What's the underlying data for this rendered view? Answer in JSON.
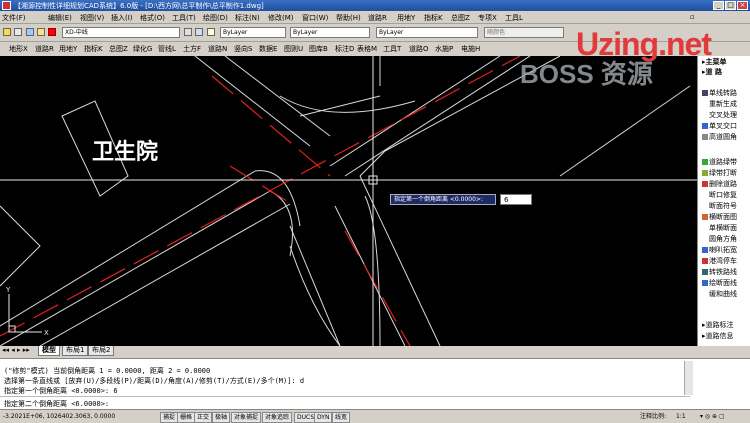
{
  "window": {
    "title": "【湘源控制性详细规划CAD系统】6.0版 - [D:\\西方网\\总平制作\\总平制作1.dwg]",
    "min": "_",
    "max": "□",
    "close": "×"
  },
  "menu": [
    {
      "label": "文件(F)"
    },
    {
      "label": "编辑(E)"
    },
    {
      "label": "视图(V)"
    },
    {
      "label": "插入(I)"
    },
    {
      "label": "格式(O)"
    },
    {
      "label": "工具(T)"
    },
    {
      "label": "绘图(D)"
    },
    {
      "label": "标注(N)"
    },
    {
      "label": "修改(M)"
    },
    {
      "label": "窗口(W)"
    },
    {
      "label": "帮助(H)"
    },
    {
      "label": "道路R"
    },
    {
      "label": "用地Y"
    },
    {
      "label": "指标K"
    },
    {
      "label": "总图Z"
    },
    {
      "label": "专项X"
    },
    {
      "label": "工具L"
    }
  ],
  "toolbar1": {
    "layer": "XD-中线",
    "color": "ByLayer",
    "linetype": "ByLayer",
    "lineweight": "ByLayer",
    "plotstyle": "随颜色"
  },
  "toolbar2": [
    {
      "label": "地形X"
    },
    {
      "label": "道路R"
    },
    {
      "label": "用地Y"
    },
    {
      "label": "指标K"
    },
    {
      "label": "总图Z"
    },
    {
      "label": "绿化G"
    },
    {
      "label": "管线L"
    },
    {
      "label": "土方F"
    },
    {
      "label": "道路N"
    },
    {
      "label": "竖向S"
    },
    {
      "label": "数据E"
    },
    {
      "label": "图则U"
    },
    {
      "label": "图库B"
    },
    {
      "label": "标注D"
    },
    {
      "label": "表格M"
    },
    {
      "label": "工具T"
    },
    {
      "label": "道路O"
    },
    {
      "label": "水施P"
    },
    {
      "label": "电施H"
    }
  ],
  "watermark": {
    "brand": "Uzing.net",
    "sub": "BOSS 资源"
  },
  "canvas": {
    "building_label": "卫生院",
    "prompt": "指定第一个倒角距离 <0.0000>:",
    "prompt_value": "6"
  },
  "right_panel": {
    "header1": "主菜单",
    "header2": "道  路",
    "items": [
      {
        "label": "单线转路",
        "color": "#333"
      },
      {
        "label": "重新生成",
        "color": "#333"
      },
      {
        "label": "交叉处理",
        "color": "#333"
      },
      {
        "label": "单叉交口",
        "color": "#333"
      },
      {
        "label": "高道圆角",
        "color": "#333"
      },
      {
        "label": "道路绿带",
        "color": "#333"
      },
      {
        "label": "绿带打断",
        "color": "#333"
      },
      {
        "label": "删除道路",
        "color": "#333"
      },
      {
        "label": "断口修复",
        "color": "#333"
      },
      {
        "label": "断面符号",
        "color": "#333"
      },
      {
        "label": "横断面图",
        "color": "#333"
      },
      {
        "label": "单横断面",
        "color": "#333"
      },
      {
        "label": "圆角方角",
        "color": "#333"
      },
      {
        "label": "喇叭拓宽",
        "color": "#333"
      },
      {
        "label": "港湾停车",
        "color": "#333"
      },
      {
        "label": "转铁路线",
        "color": "#333"
      },
      {
        "label": "绘断面线",
        "color": "#333"
      },
      {
        "label": "缓和曲线",
        "color": "#333"
      },
      {
        "label": "道路标注",
        "color": "#333"
      },
      {
        "label": "道路信息",
        "color": "#333"
      }
    ]
  },
  "tabs": [
    {
      "label": "模型"
    },
    {
      "label": "布局1"
    },
    {
      "label": "布局2"
    }
  ],
  "command": {
    "lines": [
      "(\"修剪\"模式) 当前倒角距离 1 = 0.0000, 距离 2 = 0.0000",
      "选择第一条直线或 [放弃(U)/多段线(P)/距离(D)/角度(A)/修剪(T)/方式(E)/多个(M)]:  d",
      "指定第一个倒角距离 <0.0000>: 6"
    ],
    "current": "指定第二个倒角距离 <6.0000>:"
  },
  "status": {
    "coords": "-3.2021E+06, 1026402.3063, 0.0000",
    "toggles": [
      "捕捉",
      "栅格",
      "正交",
      "极轴",
      "对象捕捉",
      "对象追踪",
      "DUCS",
      "DYN",
      "线宽"
    ],
    "scale_label": "注释比例:",
    "scale": "1:1"
  }
}
